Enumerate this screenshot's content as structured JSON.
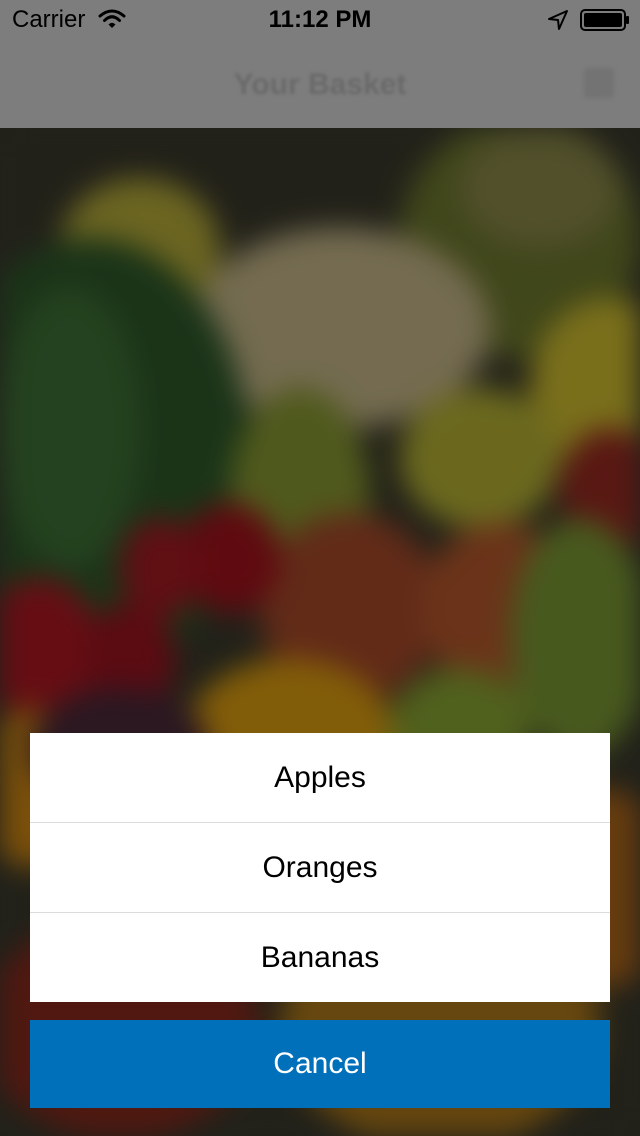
{
  "status_bar": {
    "carrier": "Carrier",
    "time": "11:12 PM",
    "icons": [
      "wifi-icon",
      "location-arrow-icon",
      "battery-icon"
    ]
  },
  "nav_bar": {
    "title": "Your Basket"
  },
  "action_sheet": {
    "options": [
      {
        "label": "Apples"
      },
      {
        "label": "Oranges"
      },
      {
        "label": "Bananas"
      }
    ],
    "cancel_label": "Cancel"
  },
  "colors": {
    "cancel_background": "#0070bb",
    "sheet_background": "#ffffff",
    "overlay": "#000000"
  }
}
